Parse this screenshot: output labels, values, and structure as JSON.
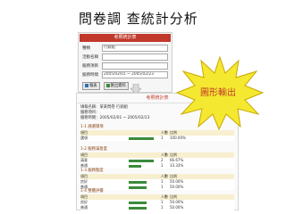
{
  "slide": {
    "title": "問卷調 查統計分析"
  },
  "search": {
    "header": "考照統計表",
    "rows": [
      {
        "label": "種類",
        "value": "行銷組"
      },
      {
        "label": "活動名稱",
        "value": ""
      },
      {
        "label": "服務項目",
        "value": ""
      },
      {
        "label": "服務時間",
        "value": "2005/02/01 ~ 2005/02/23"
      }
    ],
    "buttons": [
      {
        "label": "報表",
        "icon": "document-icon"
      },
      {
        "label": "匯出資料",
        "icon": "export-icon"
      }
    ]
  },
  "result": {
    "header": "考照統計表",
    "info": [
      "填報名稱：某某問卷 行銷組",
      "服務項目：",
      "服務時間：2005/02/01 ~ 2005/02/23"
    ],
    "columns": [
      "項目",
      "",
      "人數",
      "比例"
    ],
    "sections": [
      {
        "title": "1-1 請選擇項",
        "rows": [
          {
            "name": "選項",
            "pct": 0.78,
            "count": "1",
            "ratio": "100.00%"
          }
        ]
      },
      {
        "title": "1-2 服務滿意度",
        "rows": [
          {
            "name": "滿意",
            "pct": 0.78,
            "count": "2",
            "ratio": "66.67%"
          },
          {
            "name": "普通",
            "pct": 0.38,
            "count": "1",
            "ratio": "33.33%"
          }
        ]
      },
      {
        "title": "1-3 服務態度",
        "rows": [
          {
            "name": "良好",
            "pct": 0.55,
            "count": "1",
            "ratio": "50.00%"
          },
          {
            "name": "普通",
            "pct": 0.55,
            "count": "1",
            "ratio": "50.00%"
          }
        ]
      },
      {
        "title": "1-4 整體評價",
        "rows": [
          {
            "name": "良好",
            "pct": 0.55,
            "count": "1",
            "ratio": "50.00%"
          },
          {
            "name": "普通",
            "pct": 0.55,
            "count": "1",
            "ratio": "50.00%"
          }
        ]
      }
    ]
  },
  "callout": {
    "text": "圖形輸出",
    "color": "#f5e830",
    "text_color": "#c0392b"
  }
}
